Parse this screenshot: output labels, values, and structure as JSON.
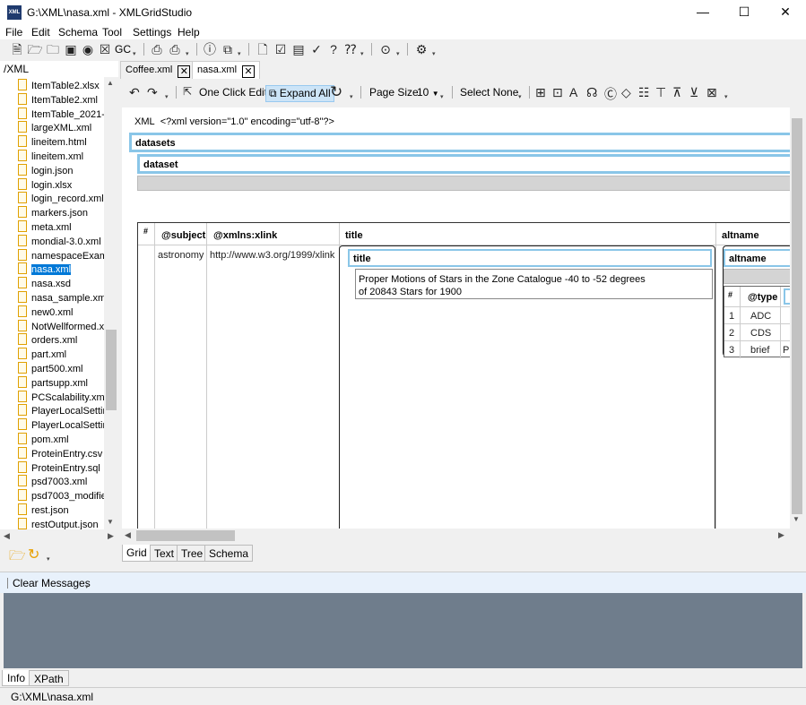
{
  "window": {
    "title": "G:\\XML\\nasa.xml - XMLGridStudio",
    "app_icon_text": "XML",
    "minimize": "—",
    "maximize": "☐",
    "close": "✕"
  },
  "menu": [
    "File",
    "Edit",
    "Schema",
    "Tool",
    "Settings",
    "Help"
  ],
  "toolbar": {
    "gc_label": "GC"
  },
  "left_panel": {
    "path": "/XML",
    "files": [
      "ItemTable2.xlsx",
      "ItemTable2.xml",
      "ItemTable_2021-",
      "largeXML.xml",
      "lineitem.html",
      "lineitem.xml",
      "login.json",
      "login.xlsx",
      "login_record.xml",
      "markers.json",
      "meta.xml",
      "mondial-3.0.xml",
      "namespaceExam",
      "nasa.xml",
      "nasa.xsd",
      "nasa_sample.xml",
      "new0.xml",
      "NotWellformed.x",
      "orders.xml",
      "part.xml",
      "part500.xml",
      "partsupp.xml",
      "PCScalability.xml",
      "PlayerLocalSettin",
      "PlayerLocalSettin",
      "pom.xml",
      "ProteinEntry.csv",
      "ProteinEntry.sql",
      "psd7003.xml",
      "psd7003_modifie",
      "rest.json",
      "restOutput.json"
    ],
    "selected_index": 13
  },
  "doc_tabs": [
    {
      "label": "Coffee.xml",
      "close": "✕"
    },
    {
      "label": "nasa.xml",
      "close": "✕"
    }
  ],
  "grid_toolbar": {
    "one_click_edit": "One Click Edit",
    "expand_all": "Expand All",
    "page_size_label": "Page Size",
    "page_size_value": "10",
    "select_none": "Select None"
  },
  "grid": {
    "xml_label": "XML",
    "xml_decl": "<?xml version=\"1.0\" encoding=\"utf-8\"?>",
    "datasets": "datasets",
    "dataset": "dataset",
    "table_headers": {
      "num": "#",
      "subject": "@subject",
      "xlink": "@xmlns:xlink",
      "title": "title",
      "altname": "altname"
    },
    "row": {
      "subject": "astronomy",
      "xlink": "http://www.w3.org/1999/xlink"
    },
    "title_box": {
      "header": "title",
      "line1": "Proper Motions of Stars in the Zone Catalogue -40 to -52 degrees",
      "line2": "of 20843 Stars for 1900"
    },
    "altname_box": {
      "header": "altname",
      "col_num": "#",
      "col_type": "@type",
      "rows": [
        {
          "n": "1",
          "type": "ADC",
          "extra": ""
        },
        {
          "n": "2",
          "type": "CDS",
          "extra": ""
        },
        {
          "n": "3",
          "type": "brief",
          "extra": "P"
        }
      ]
    }
  },
  "view_tabs": [
    "Grid",
    "Text",
    "Tree",
    "Schema"
  ],
  "messages": {
    "clear": "Clear Messages"
  },
  "bottom_tabs": [
    "Info",
    "XPath"
  ],
  "status": "G:\\XML\\nasa.xml"
}
